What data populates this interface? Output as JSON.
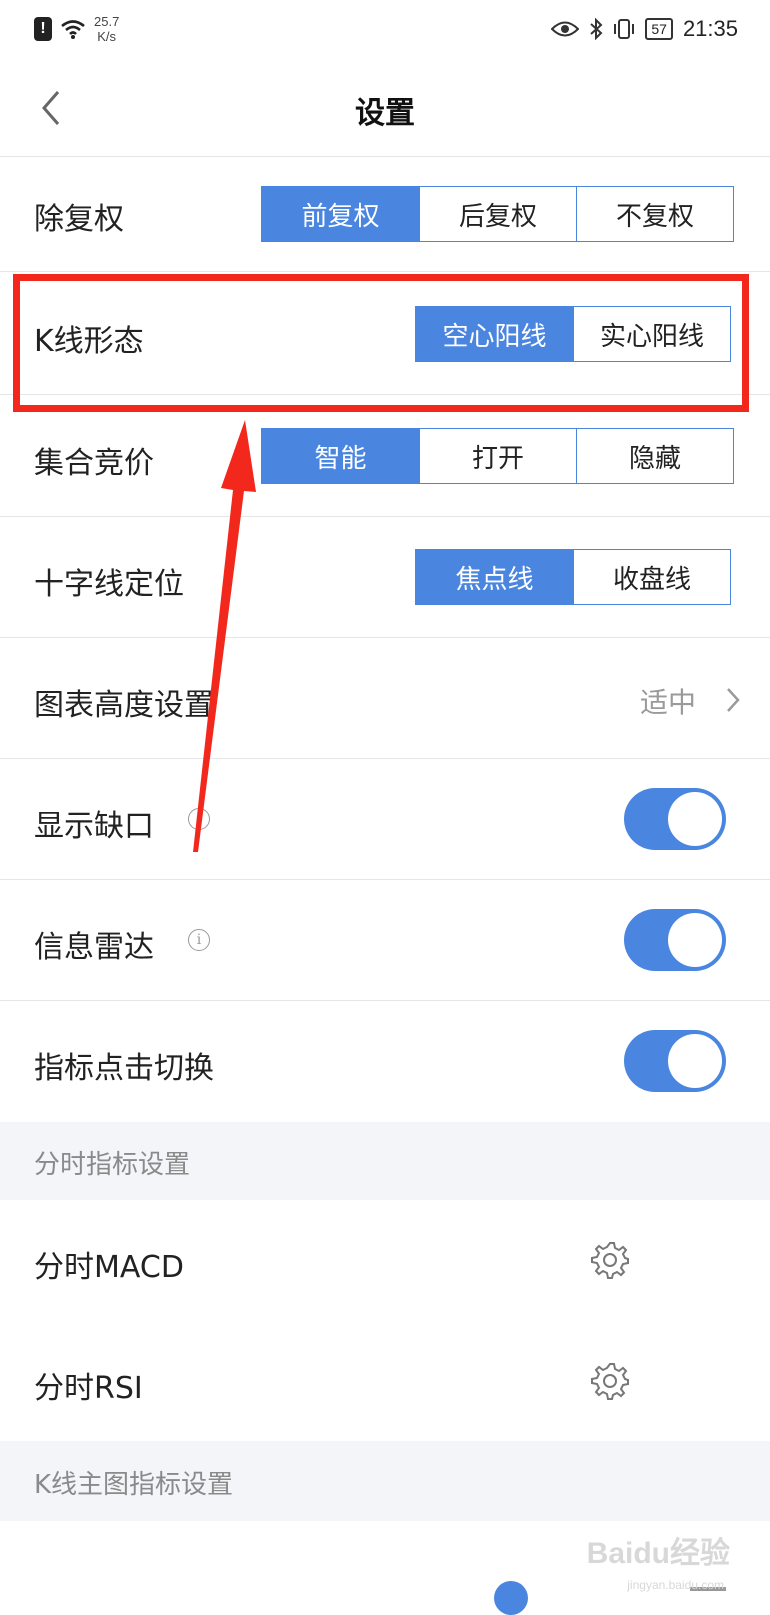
{
  "status_bar": {
    "alert": "!",
    "speed_value": "25.7",
    "speed_unit": "K/s",
    "battery": "57",
    "time": "21:35"
  },
  "header": {
    "title": "设置"
  },
  "rows": {
    "rights": {
      "label": "除复权",
      "options": [
        "前复权",
        "后复权",
        "不复权"
      ],
      "selected": "前复权"
    },
    "kline_style": {
      "label": "K线形态",
      "options": [
        "空心阳线",
        "实心阳线"
      ],
      "selected": "空心阳线"
    },
    "auction": {
      "label": "集合竞价",
      "options": [
        "智能",
        "打开",
        "隐藏"
      ],
      "selected": "智能"
    },
    "crosshair": {
      "label": "十字线定位",
      "options": [
        "焦点线",
        "收盘线"
      ],
      "selected": "焦点线"
    },
    "chart_height": {
      "label": "图表高度设置",
      "value": "适中"
    },
    "show_gap": {
      "label": "显示缺口",
      "on": true
    },
    "info_radar": {
      "label": "信息雷达",
      "on": true
    },
    "indicator_tap": {
      "label": "指标点击切换",
      "on": true
    }
  },
  "section_intraday": {
    "title": "分时指标设置",
    "items": [
      "分时MACD",
      "分时RSI"
    ]
  },
  "section_kline": {
    "title": "K线主图指标设置"
  },
  "watermark": {
    "text": "Baidu经验",
    "sub": "jingyan.baidu.com"
  },
  "colors": {
    "accent": "#4a86e0",
    "highlight": "#f2281c",
    "section_bg": "#f3f5f8"
  }
}
